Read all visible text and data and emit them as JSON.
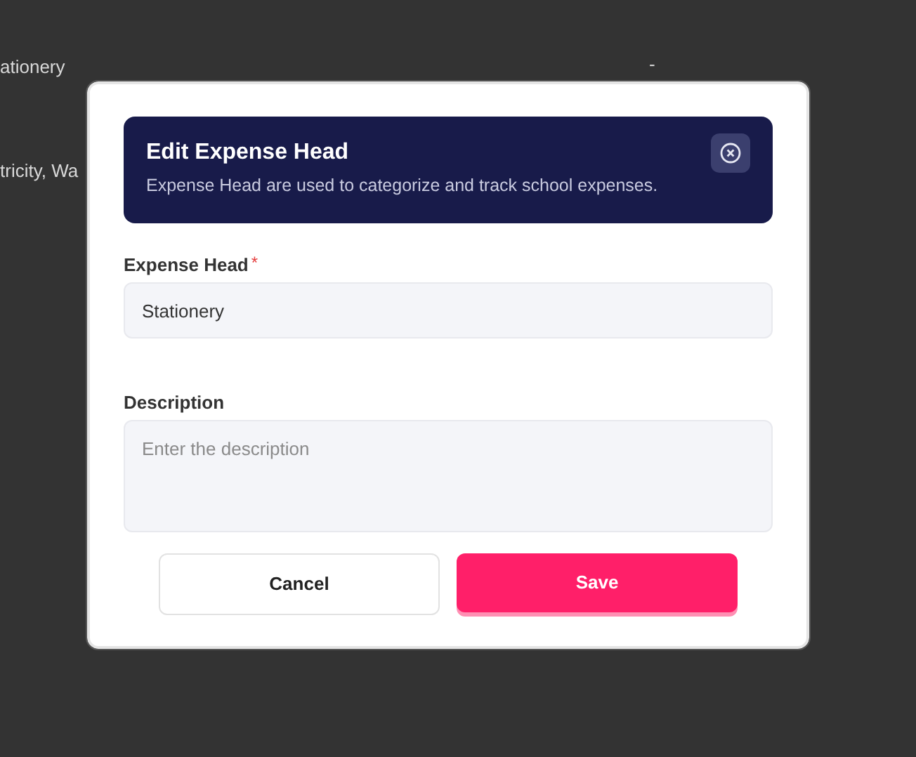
{
  "background_rows": [
    {
      "cells": [
        "ationery",
        "-"
      ]
    },
    {
      "cells": [
        "tricity, Wa"
      ]
    }
  ],
  "dialog": {
    "title": "Edit Expense Head",
    "subtitle": "Expense Head are used to categorize and track school expenses.",
    "fields": [
      {
        "kind": "input",
        "label": "Expense Head",
        "required_mark": "*",
        "value": "Stationery"
      },
      {
        "kind": "textarea",
        "label": "Description",
        "placeholder": "Enter the description"
      }
    ],
    "buttons": [
      {
        "kind": "secondary",
        "label": "Cancel"
      },
      {
        "kind": "primary",
        "label": "Save"
      }
    ]
  }
}
